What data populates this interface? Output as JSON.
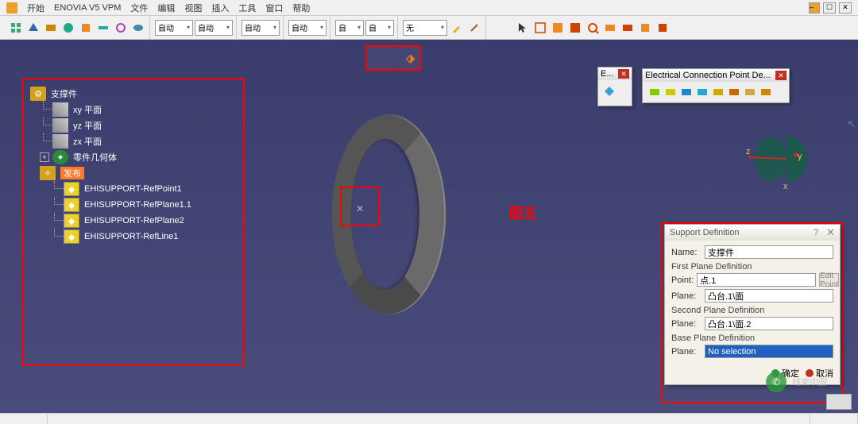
{
  "menu": {
    "start": "开始",
    "vpm": "ENOVIA V5 VPM",
    "file": "文件",
    "edit": "编辑",
    "view": "视图",
    "insert": "插入",
    "tools": "工具",
    "window": "窗口",
    "help": "帮助"
  },
  "toolbar": {
    "auto": "自动",
    "none": "无"
  },
  "tree": {
    "root": "支撑件",
    "planes": [
      "xy 平面",
      "yz 平面",
      "zx 平面"
    ],
    "body": "零件几何体",
    "publish": "发布",
    "pubs": [
      "EHISUPPORT-RefPoint1",
      "EHISUPPORT-RefPlane1.1",
      "EHISUPPORT-RefPlane2",
      "EHISUPPORT-RefLine1"
    ]
  },
  "fig_label": "图五",
  "compass": {
    "x": "x",
    "y": "y",
    "z": "z"
  },
  "e_panel": {
    "title": "E..."
  },
  "ec_panel": {
    "title": "Electrical Connection Point De..."
  },
  "sd": {
    "title": "Support Definition",
    "name_lbl": "Name:",
    "name_val": "支撑件",
    "sect1": "First Plane Definition",
    "point_lbl": "Point:",
    "point_val": "点.1",
    "edit_point": "Edit Point",
    "plane_lbl": "Plane:",
    "plane1_val": "凸台.1\\面",
    "sect2": "Second Plane Definition",
    "plane2_val": "凸台.1\\面.2",
    "sect3": "Base Plane Definition",
    "plane3_val": "No selection",
    "ok": "确定",
    "cancel": "取消"
  },
  "watermark": "线束中国"
}
